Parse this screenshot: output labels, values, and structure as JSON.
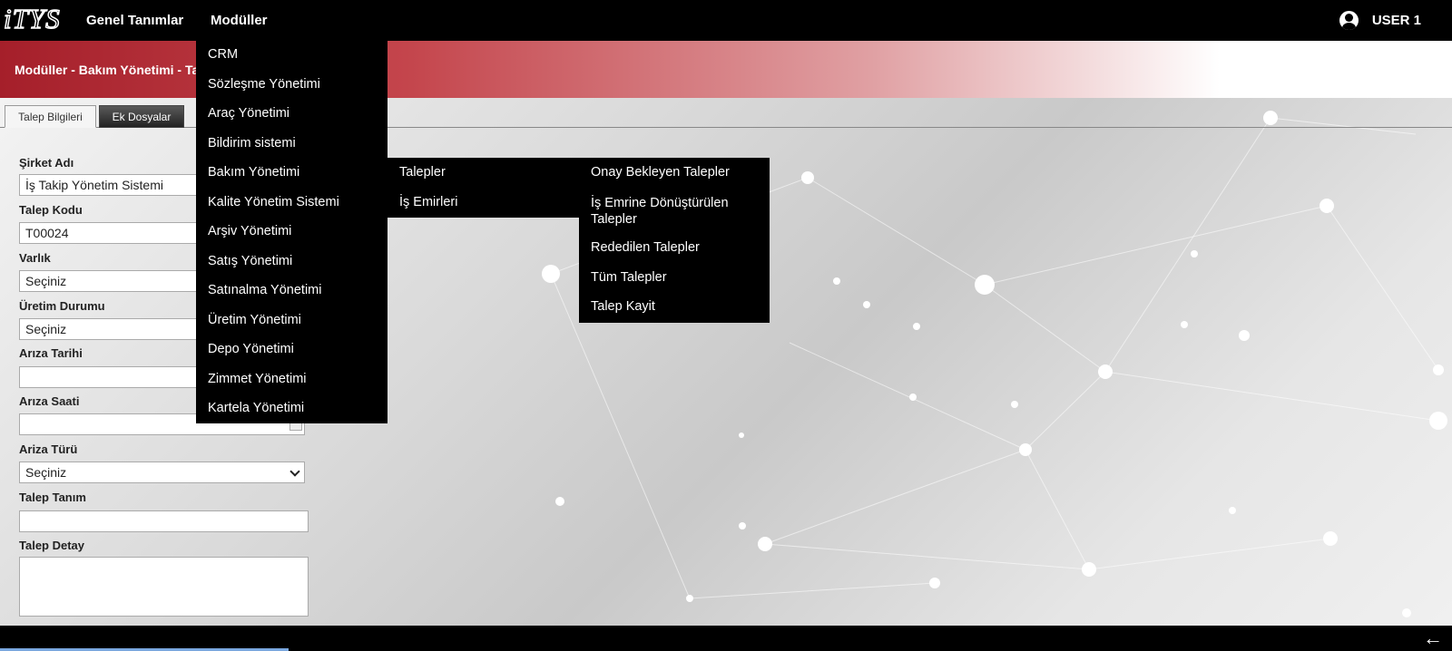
{
  "app": {
    "logo": "iTYS"
  },
  "topnav": {
    "genel": "Genel Tanımlar",
    "moduller": "Modüller",
    "user": "USER 1"
  },
  "header": {
    "title": "Modüller - Bakım Yönetimi - Talepler"
  },
  "tabs": [
    {
      "label": "Talep Bilgileri"
    },
    {
      "label": "Ek Dosyalar"
    }
  ],
  "form": {
    "sirket_adi": {
      "label": "Şirket Adı",
      "value": "İş Takip Yönetim Sistemi"
    },
    "talep_kodu": {
      "label": "Talep Kodu",
      "value": "T00024"
    },
    "varlik": {
      "label": "Varlık",
      "value": "Seçiniz"
    },
    "uretim_durumu": {
      "label": "Üretim Durumu",
      "value": "Seçiniz"
    },
    "ariza_tarihi": {
      "label": "Arıza Tarihi",
      "value": ""
    },
    "ariza_saati": {
      "label": "Arıza Saati",
      "value": ""
    },
    "ariza_turu": {
      "label": "Ariza Türü",
      "value": "Seçiniz"
    },
    "talep_tanim": {
      "label": "Talep Tanım",
      "value": ""
    },
    "talep_detay": {
      "label": "Talep Detay",
      "value": ""
    }
  },
  "menu_moduller": [
    {
      "label": "CRM"
    },
    {
      "label": "Sözleşme Yönetimi"
    },
    {
      "label": "Araç Yönetimi"
    },
    {
      "label": "Bildirim sistemi"
    },
    {
      "label": "Bakım Yönetimi"
    },
    {
      "label": "Kalite Yönetim Sistemi"
    },
    {
      "label": "Arşiv Yönetimi"
    },
    {
      "label": "Satış Yönetimi"
    },
    {
      "label": "Satınalma Yönetimi"
    },
    {
      "label": "Üretim Yönetimi"
    },
    {
      "label": "Depo Yönetimi"
    },
    {
      "label": "Zimmet Yönetimi"
    },
    {
      "label": "Kartela Yönetimi"
    }
  ],
  "menu_bakim": [
    {
      "label": "Talepler"
    },
    {
      "label": "İş Emirleri"
    }
  ],
  "menu_talepler": [
    {
      "label": "Onay Bekleyen Talepler"
    },
    {
      "label": "İş Emrine Dönüştürülen Talepler"
    },
    {
      "label": "Rededilen Talepler"
    },
    {
      "label": "Tüm Talepler"
    },
    {
      "label": "Talep Kayit"
    }
  ],
  "icons": {
    "user": "user-circle-icon",
    "back": "arrow-left-icon"
  }
}
